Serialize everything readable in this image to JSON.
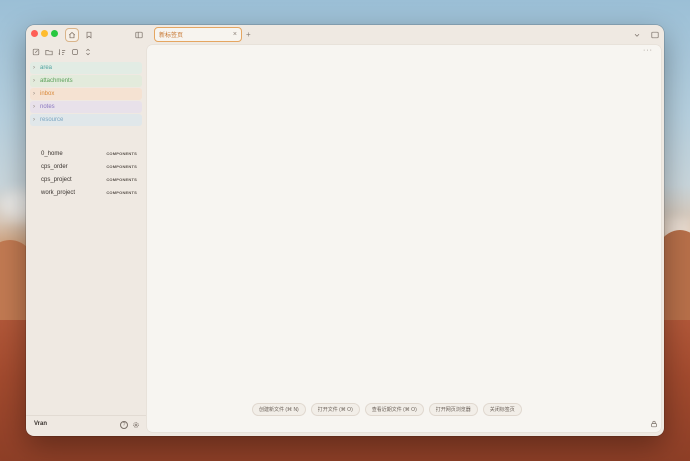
{
  "tab": {
    "title": "新标签页",
    "close": "×",
    "add": "+"
  },
  "sidebar": {
    "folders": [
      {
        "label": "area",
        "color": "#4fa3a0",
        "bg": "#e2ece4"
      },
      {
        "label": "attachments",
        "color": "#5aa058",
        "bg": "#e3ebdc"
      },
      {
        "label": "inbox",
        "color": "#d98a3b",
        "bg": "#f5e2d2"
      },
      {
        "label": "notes",
        "color": "#8a77c0",
        "bg": "#e8e1ea"
      },
      {
        "label": "resource",
        "color": "#7aa6c2",
        "bg": "#e0e7ea"
      }
    ],
    "files": [
      {
        "label": "0_home",
        "tag": "COMPONENTS"
      },
      {
        "label": "cps_order",
        "tag": "COMPONENTS"
      },
      {
        "label": "cps_project",
        "tag": "COMPONENTS"
      },
      {
        "label": "work_project",
        "tag": "COMPONENTS"
      }
    ],
    "vault_name": "Vran"
  },
  "main": {
    "more": "···",
    "actions": [
      {
        "label": "创建新文件 (⌘ N)"
      },
      {
        "label": "打开文件 (⌘ O)"
      },
      {
        "label": "查看近期文件 (⌘ O)"
      },
      {
        "label": "打开网页浏览器"
      },
      {
        "label": "关闭标签页"
      }
    ]
  }
}
